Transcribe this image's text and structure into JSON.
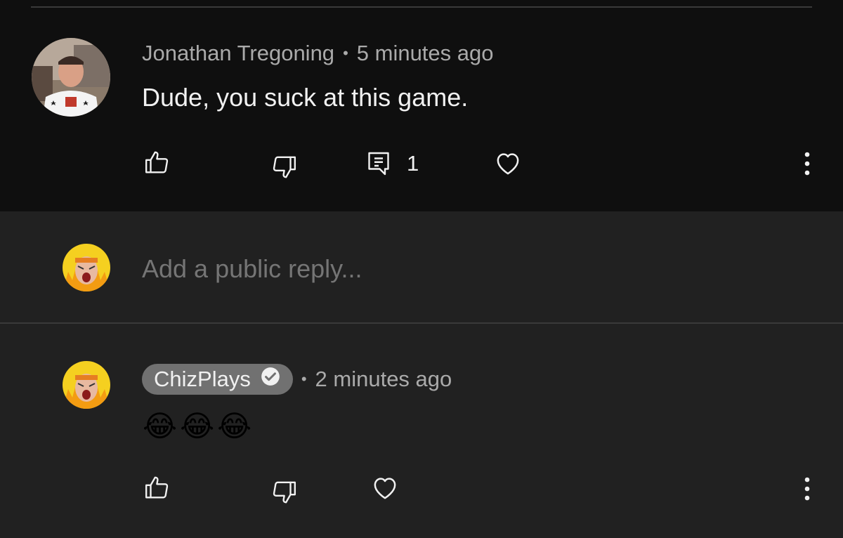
{
  "parent_comment": {
    "author": "Jonathan Tregoning",
    "separator": "•",
    "timestamp": "5 minutes ago",
    "text": "Dude, you suck at this game.",
    "reply_count": "1"
  },
  "reply_box": {
    "placeholder": "Add a public reply..."
  },
  "reply_comment": {
    "author": "ChizPlays",
    "separator": "•",
    "timestamp": "2 minutes ago",
    "emoji": [
      "😂",
      "😂",
      "😂"
    ]
  },
  "colors": {
    "background": "#0f0f0f",
    "reply_background": "#212121",
    "secondary_text": "#aaaaaa",
    "primary_text": "#f1f1f1",
    "author_chip": "#717171"
  }
}
